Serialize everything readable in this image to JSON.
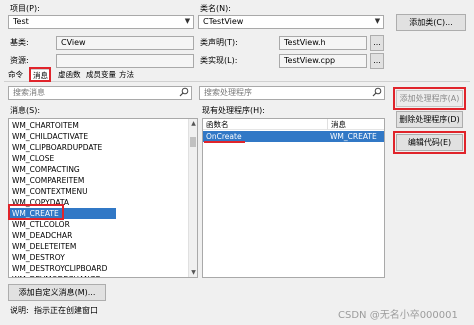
{
  "labels": {
    "project": "项目(P):",
    "class_name": "类名(N):",
    "base_class": "基类:",
    "class_declaration": "类声明(T):",
    "resource": "资源:",
    "class_implementation": "类实现(L):",
    "messages_list": "消息(S):",
    "existing_handlers": "现有处理程序(H):",
    "description": "说明:",
    "description_text": "指示正在创建窗口"
  },
  "fields": {
    "project": "Test",
    "class_name": "CTestView",
    "base_class": "CView",
    "class_declaration": "TestView.h",
    "resource": "",
    "class_implementation": "TestView.cpp",
    "search_messages_placeholder": "搜索消息",
    "search_handlers_placeholder": "搜索处理程序"
  },
  "buttons": {
    "add_class": "添加类(C)...",
    "add_handler": "添加处理程序(A)",
    "delete_handler": "删除处理程序(D)",
    "edit_code": "编辑代码(E)",
    "add_custom_message": "添加自定义消息(M)...",
    "browse": "..."
  },
  "tabs": [
    {
      "label": "命令"
    },
    {
      "label": "消息"
    },
    {
      "label": "虚函数"
    },
    {
      "label": "成员变量"
    },
    {
      "label": "方法"
    }
  ],
  "messages": [
    "WM_CHARTOITEM",
    "WM_CHILDACTIVATE",
    "WM_CLIPBOARDUPDATE",
    "WM_CLOSE",
    "WM_COMPACTING",
    "WM_COMPAREITEM",
    "WM_CONTEXTMENU",
    "WM_COPYDATA",
    "WM_CREATE",
    "WM_CTLCOLOR",
    "WM_DEADCHAR",
    "WM_DELETEITEM",
    "WM_DESTROY",
    "WM_DESTROYCLIPBOARD",
    "WM_DEVMODECHANGE"
  ],
  "handlers_table": {
    "columns": [
      "函数名",
      "消息"
    ],
    "rows": [
      {
        "function": "OnCreate",
        "message": "WM_CREATE"
      }
    ]
  },
  "watermark": "CSDN @无名小卒000001"
}
